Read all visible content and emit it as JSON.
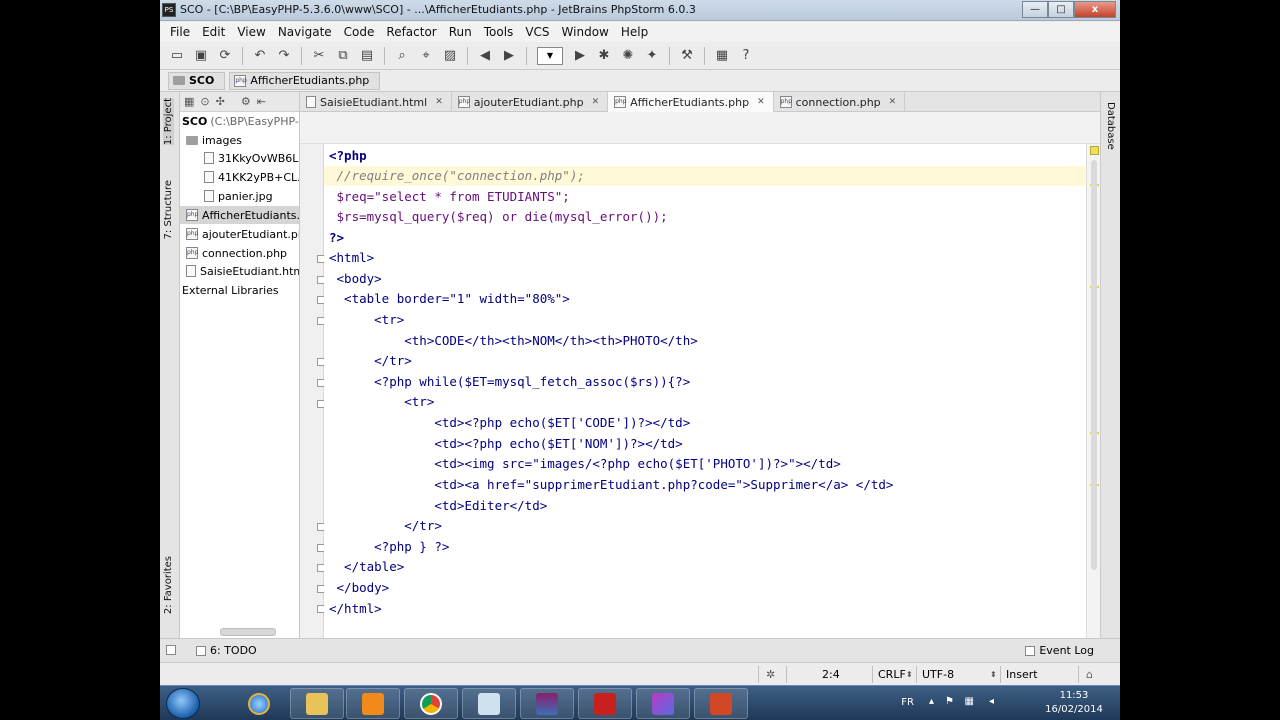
{
  "title": "SCO - [C:\\BP\\EasyPHP-5.3.6.0\\www\\SCO] - ...\\AfficherEtudiants.php - JetBrains PhpStorm 6.0.3",
  "window_buttons": {
    "minimize": "—",
    "maximize": "□",
    "close": "x"
  },
  "menu": [
    "File",
    "Edit",
    "View",
    "Navigate",
    "Code",
    "Refactor",
    "Run",
    "Tools",
    "VCS",
    "Window",
    "Help"
  ],
  "breadcrumb": {
    "project": "SCO",
    "file": "AfficherEtudiants.php"
  },
  "left_tabs": {
    "project": "1: Project",
    "structure": "7: Structure",
    "favorites": "2: Favorites"
  },
  "right_tabs": {
    "database": "Database"
  },
  "project_tree": {
    "root": "SCO",
    "root_path": "(C:\\BP\\EasyPHP-5.",
    "items": [
      {
        "label": "images"
      },
      {
        "label": "31KkyOvWB6L._"
      },
      {
        "label": "41KK2yPB+CL._A"
      },
      {
        "label": "panier.jpg"
      },
      {
        "label": "AfficherEtudiants.ph"
      },
      {
        "label": "ajouterEtudiant.php"
      },
      {
        "label": "connection.php"
      },
      {
        "label": "SaisieEtudiant.html"
      },
      {
        "label": "External Libraries"
      }
    ]
  },
  "tabs": [
    {
      "label": "SaisieEtudiant.html",
      "icon": "html"
    },
    {
      "label": "ajouterEtudiant.php",
      "icon": "php"
    },
    {
      "label": "AfficherEtudiants.php",
      "icon": "php",
      "active": true
    },
    {
      "label": "connection.php",
      "icon": "php"
    }
  ],
  "code_lines": [
    "<?php",
    " //require_once(\"connection.php\");",
    " $req=\"select * from ETUDIANTS\";",
    " $rs=mysql_query($req) or die(mysql_error());",
    "?>",
    "<html>",
    " <body>",
    "  <table border=\"1\" width=\"80%\">",
    "      <tr>",
    "          <th>CODE</th><th>NOM</th><th>PHOTO</th>",
    "      </tr>",
    "      <?php while($ET=mysql_fetch_assoc($rs)){?>",
    "          <tr>",
    "              <td><?php echo($ET['CODE'])?></td>",
    "              <td><?php echo($ET['NOM'])?></td>",
    "              <td><img src=\"images/<?php echo($ET['PHOTO'])?>\"></td>",
    "              <td><a href=\"supprimerEtudiant.php?code=\">Supprimer</a> </td>",
    "              <td>Editer</td>",
    "          </tr>",
    "      <?php } ?>",
    "  </table>",
    " </body>",
    "</html>"
  ],
  "bottom": {
    "todo": "6: TODO",
    "event_log": "Event Log"
  },
  "status": {
    "position": "2:4",
    "line_sep": "CRLF",
    "encoding": "UTF-8",
    "mode": "Insert"
  },
  "tray": {
    "lang": "FR",
    "time": "11:53",
    "date": "16/02/2014"
  },
  "colors": {
    "keyword": "#000080",
    "string": "#006400",
    "variable": "#660e7a",
    "comment": "#808080",
    "current_line": "#fff9d8"
  }
}
